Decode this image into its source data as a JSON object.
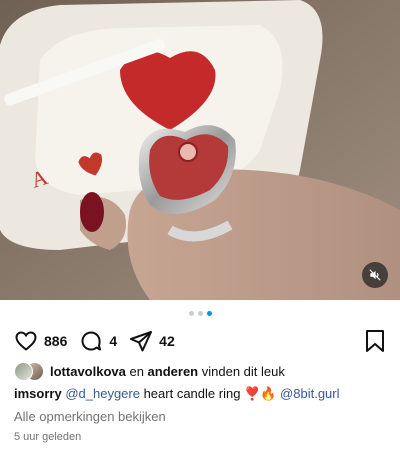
{
  "post": {
    "mute_icon": "muted-speaker-icon",
    "carousel": {
      "total": 3,
      "active_index": 2
    },
    "actions": {
      "like_icon": "heart-outline-icon",
      "like_count": "886",
      "comment_icon": "comment-bubble-icon",
      "comment_count": "4",
      "share_icon": "paper-plane-icon",
      "share_count": "42",
      "save_icon": "bookmark-icon"
    },
    "likes": {
      "user": "lottavolkova",
      "connector": " en ",
      "others": "anderen",
      "suffix": " vinden dit leuk"
    },
    "caption": {
      "username": "imsorry",
      "mention": "@d_heygere",
      "text": " heart candle ring ",
      "emojis": "❣️🔥",
      "tag": "@8bit.gurl"
    },
    "view_comments": "Alle opmerkingen bekijken",
    "timestamp": "5 uur geleden",
    "colors": {
      "accent_blue": "#0095f6",
      "mention_blue": "#385898",
      "muted_text": "#737373"
    }
  }
}
